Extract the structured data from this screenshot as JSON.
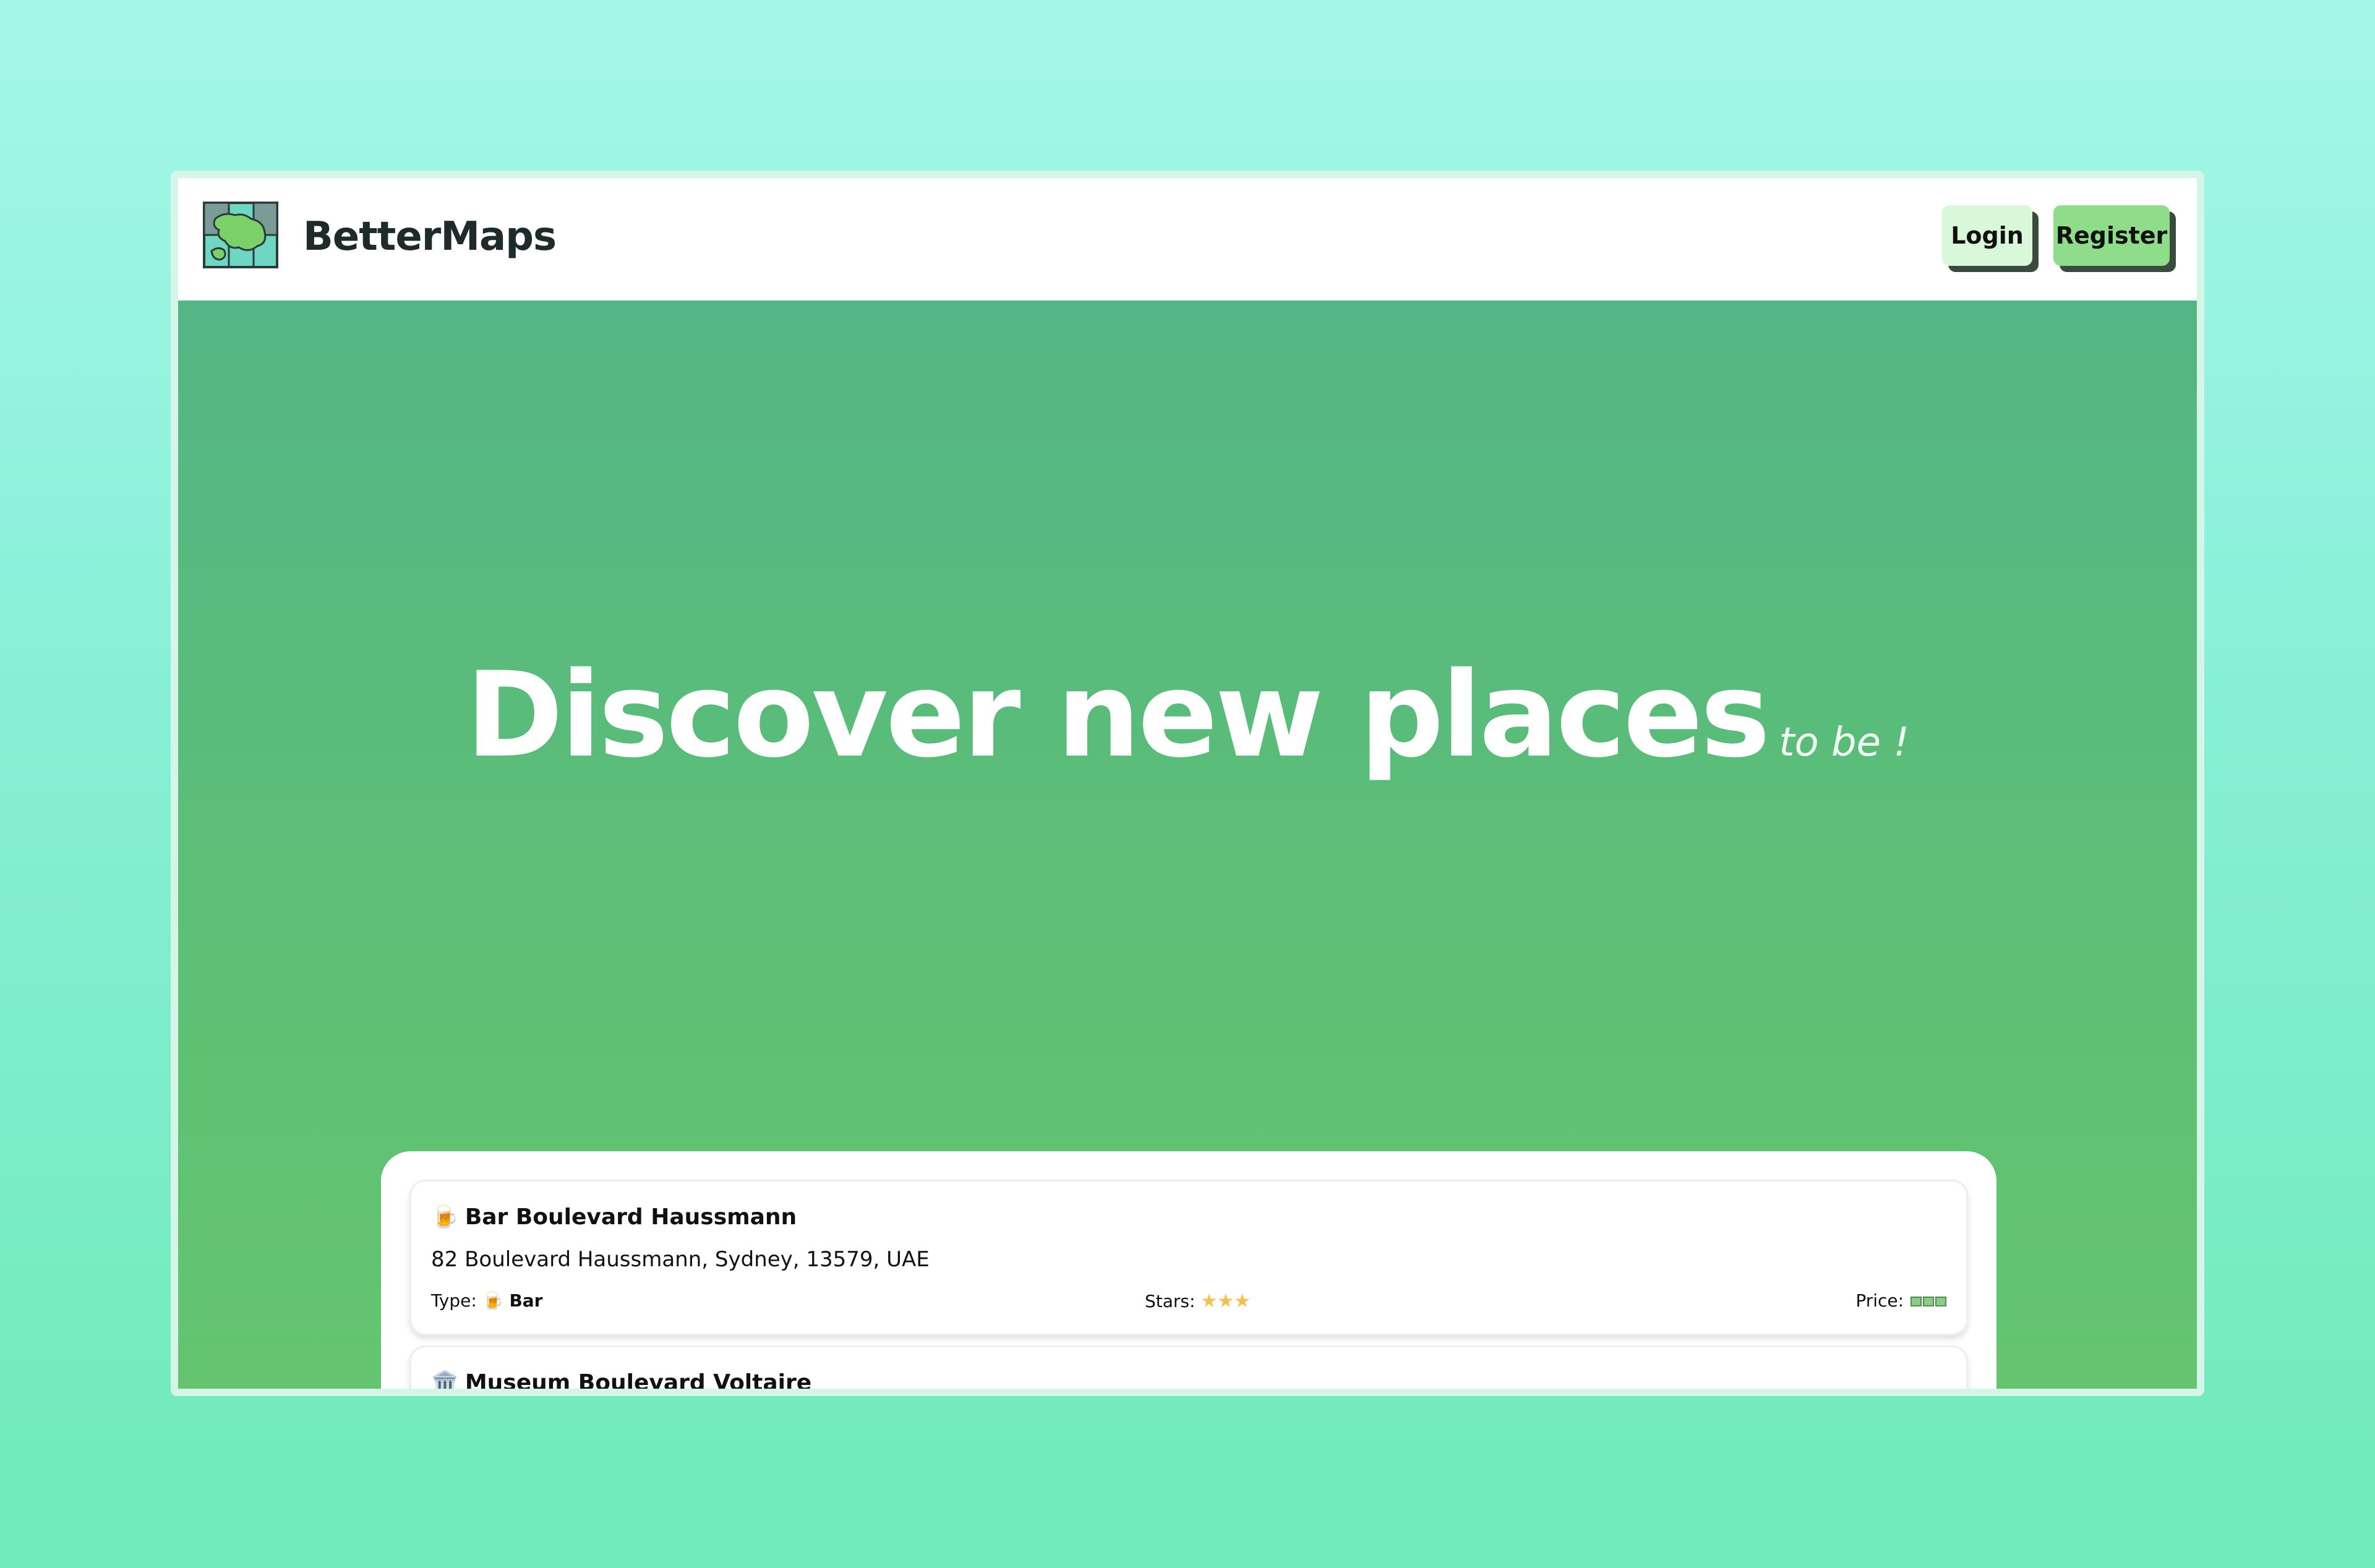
{
  "brand": {
    "name": "BetterMaps",
    "logo_icon": "map-icon"
  },
  "nav": {
    "login_label": "Login",
    "register_label": "Register"
  },
  "hero": {
    "headline": "Discover new places",
    "tagline": "to be !"
  },
  "places": [
    {
      "icon": "🍺",
      "name": "Bar Boulevard Haussmann",
      "address": "82 Boulevard Haussmann, Sydney, 13579, UAE",
      "type_label": "Type:",
      "type_icon": "🍺",
      "type_value": "Bar",
      "stars_label": "Stars:",
      "stars": 3,
      "price_label": "Price:",
      "price_level": 3
    },
    {
      "icon": "🏛️",
      "name": "Museum Boulevard Voltaire"
    }
  ],
  "colors": {
    "hero_top": "#54b586",
    "hero_bottom": "#64c470",
    "login_bg": "#d8f8d9",
    "register_bg": "#8fdc8a"
  }
}
